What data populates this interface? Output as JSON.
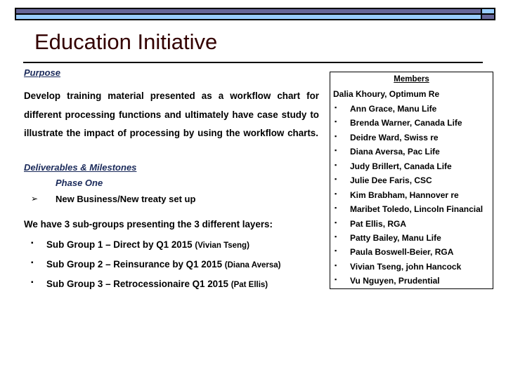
{
  "header": {
    "decor_colors": {
      "dark": "#666699",
      "light": "#99ccff"
    },
    "title": "Education Initiative",
    "title_color": "#330000"
  },
  "purpose": {
    "heading": "Purpose",
    "text": "Develop training material presented as a workflow chart for different processing functions and ultimately have case study to illustrate the impact of processing by using the workflow charts."
  },
  "deliverables": {
    "heading": "Deliverables & Milestones",
    "phase": "Phase One",
    "phase_item_bullet": "➢",
    "phase_item": "New Business/New treaty set up",
    "subgroups_intro": "We have 3  sub-groups  presenting the 3 different layers:",
    "subgroups": [
      {
        "bullet": "▪",
        "label": "Sub Group 1 – Direct by Q1 2015",
        "lead": "(Vivian Tseng)"
      },
      {
        "bullet": "▪",
        "label": "Sub Group 2 – Reinsurance by Q1 2015",
        "lead": "(Diana Aversa)"
      },
      {
        "bullet": "▪",
        "label": "Sub Group 3 – Retrocessionaire Q1 2015",
        "lead": "(Pat Ellis)"
      }
    ]
  },
  "members": {
    "heading": "Members",
    "lead": "Dalia Khoury, Optimum Re",
    "bullet": "▪",
    "list": [
      "Ann Grace, Manu Life",
      "Brenda Warner, Canada Life",
      "Deidre Ward, Swiss re",
      "Diana Aversa, Pac Life",
      "Judy Brillert, Canada Life",
      "Julie Dee Faris, CSC",
      "Kim Brabham, Hannover re",
      "Maribet Toledo, Lincoln Financial",
      "Pat Ellis, RGA",
      "Patty Bailey, Manu Life",
      "Paula Boswell-Beier, RGA",
      "Vivian Tseng, john Hancock",
      "Vu Nguyen, Prudential"
    ]
  }
}
